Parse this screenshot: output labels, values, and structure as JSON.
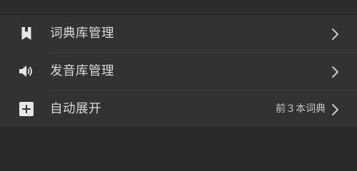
{
  "settings": {
    "items": [
      {
        "label": "词典库管理",
        "icon": "bookmark-icon",
        "value": ""
      },
      {
        "label": "发音库管理",
        "icon": "speaker-icon",
        "value": ""
      },
      {
        "label": "自动展开",
        "icon": "plus-square-icon",
        "value": "前３本词典"
      }
    ]
  },
  "colors": {
    "background": "#27292b",
    "row_background": "#303234",
    "text": "#d9dadb",
    "secondary_text": "#c2c4c6",
    "icon": "#e4e5e6",
    "chevron": "#c8cacc",
    "divider": "#3e4042"
  }
}
